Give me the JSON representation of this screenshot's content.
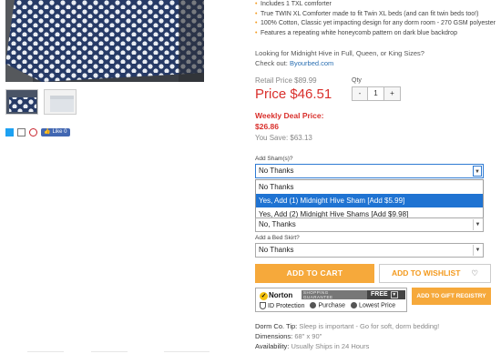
{
  "features": [
    "Includes 1 TXL comforter",
    "True TWIN XL Comforter made to fit Twin XL beds (and can fit twin beds too!)",
    "100% Cotton, Classic yet impacting design for any dorm room - 270 GSM polyester",
    "Features a repeating white honeycomb pattern on dark blue backdrop"
  ],
  "sizes_question": "Looking for Midnight Hive in Full, Queen, or King Sizes?",
  "check_out_prefix": "Check out: ",
  "check_out_link": "Byourbed.com",
  "retail_price": "Retail Price $89.99",
  "price": "Price $46.51",
  "qty": {
    "label": "Qty",
    "minus": "-",
    "value": "1",
    "plus": "+"
  },
  "weekly_deal_label": "Weekly Deal Price:",
  "weekly_deal_price": "$26.86",
  "you_save": "You Save: $63.13",
  "shams": {
    "label": "Add Sham(s)?",
    "selected": "No Thanks",
    "options": [
      "No Thanks",
      "Yes, Add (1) Midnight Hive Sham [Add $5.99]",
      "Yes, Add (2) Midnight Hive Shams [Add $9.98]"
    ],
    "highlighted_index": 1
  },
  "hidden_select_value": "No, Thanks",
  "bed_skirt": {
    "label": "Add a Bed Skirt?",
    "selected": "No Thanks"
  },
  "add_to_cart": "ADD TO CART",
  "add_to_wishlist": "ADD TO WISHLIST",
  "add_to_gift_registry": "ADD TO GIFT REGISTRY",
  "norton": {
    "brand": "Norton",
    "guarantee_line1": "SHOPPING",
    "guarantee_line2": "GUARANTEE",
    "free": "FREE",
    "features": [
      "ID Protection",
      "Purchase",
      "Lowest Price"
    ]
  },
  "dorm_tip_label": "Dorm Co. Tip: ",
  "dorm_tip_value": "Sleep is important - Go for soft, dorm bedding!",
  "dimensions_label": "Dimensions: ",
  "dimensions_value": "68\" x 90\"",
  "availability_label": "Availability: ",
  "availability_value": "Usually Ships in 24 Hours",
  "social": {
    "like": "Like 0"
  },
  "colors": {
    "accent": "#f6a93b",
    "price": "#d9302c",
    "link": "#2a6fb2",
    "dropdown_highlight": "#1f73d2"
  }
}
